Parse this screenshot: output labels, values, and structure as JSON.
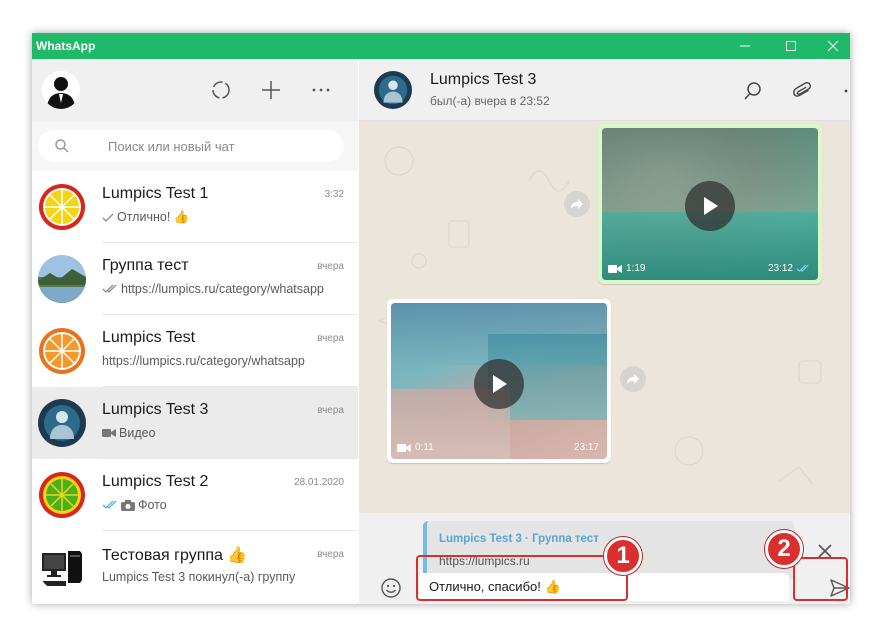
{
  "window": {
    "title": "WhatsApp"
  },
  "search": {
    "placeholder": "Поиск или новый чат"
  },
  "chats": [
    {
      "name": "Lumpics Test 1",
      "time": "3:32",
      "preview": "Отлично! 👍",
      "ticks": "single"
    },
    {
      "name": "Группа тест",
      "time": "вчера",
      "preview": "https://lumpics.ru/category/whatsapp",
      "ticks": "double-grey"
    },
    {
      "name": "Lumpics Test",
      "time": "вчера",
      "preview": "https://lumpics.ru/category/whatsapp",
      "ticks": "none"
    },
    {
      "name": "Lumpics Test 3",
      "time": "вчера",
      "preview": "Видео",
      "ticks": "video"
    },
    {
      "name": "Lumpics Test 2",
      "time": "28.01.2020",
      "preview": "Фото",
      "ticks": "double-blue-photo"
    },
    {
      "name": "Тестовая группа 👍",
      "time": "вчера",
      "preview": "Lumpics Test 3 покинул(-а) группу",
      "ticks": "none"
    }
  ],
  "active_chat": {
    "name": "Lumpics Test 3",
    "status": "был(-а) вчера в 23:52"
  },
  "messages": [
    {
      "direction": "out",
      "kind": "video",
      "duration": "1:19",
      "time": "23:12"
    },
    {
      "direction": "in",
      "kind": "video",
      "duration": "0:11",
      "time": "23:17"
    }
  ],
  "composer": {
    "quote_title": "Lumpics Test 3 · Группа тест",
    "quote_text": "https://lumpics.ru",
    "input_value": "Отлично, спасибо! 👍"
  },
  "annotations": {
    "badge_1": "1",
    "badge_2": "2"
  },
  "colors": {
    "titlebar": "#1fb96a",
    "accent_blue": "#56a6d2",
    "highlight": "#d9302f",
    "out_bubble": "#dcf8c6",
    "chat_bg": "#ece5dc"
  }
}
